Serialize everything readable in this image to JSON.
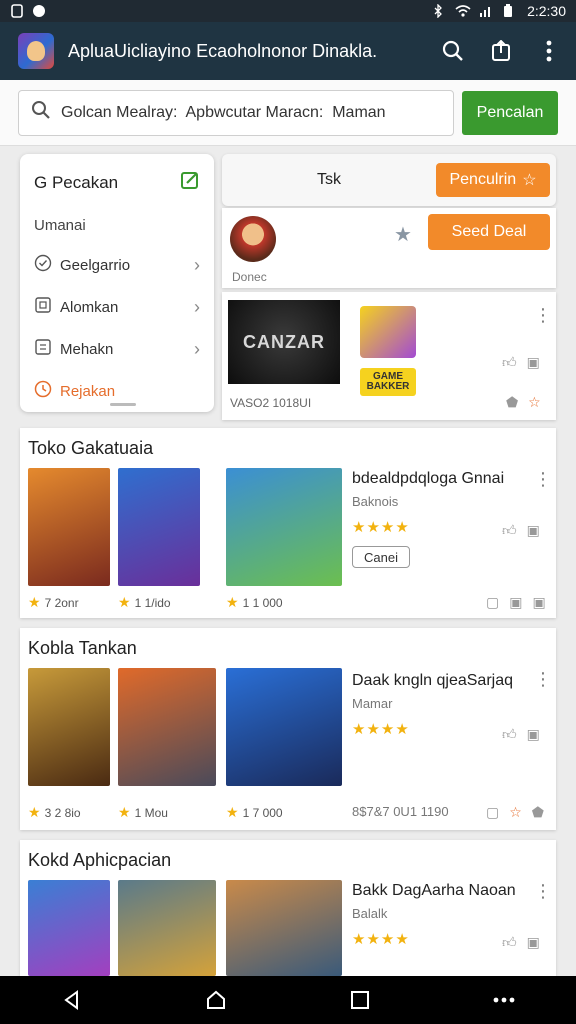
{
  "status_bar": {
    "time": "2:2:30"
  },
  "app_bar": {
    "title": "ApluaUicliayino Ecaoholnonor Dinakla."
  },
  "search": {
    "value": "Golcan Mealray:  Apbwcutar Maracn:  Maman",
    "button": "Pencalan"
  },
  "side_menu": {
    "title": "G Pecakan",
    "subtitle": "Umanai",
    "items": [
      {
        "label": "Geelgarrio"
      },
      {
        "label": "Alomkan"
      },
      {
        "label": "Mehakn"
      }
    ],
    "accent_item": "Rejakan"
  },
  "tab_card": {
    "label": "Tsk",
    "button": "Penculrin"
  },
  "profile_card": {
    "sub": "Donec",
    "button": "Seed Deal"
  },
  "feature_card": {
    "game_title": "CANZAR",
    "badge": "GAME BAKKER",
    "caption": "VASO2 1018UI"
  },
  "sections": [
    {
      "title": "Toko Gakatuaia",
      "tiles": [
        {
          "count": "7 2onr"
        },
        {
          "count": "1 1/ido"
        },
        {
          "count": "1 1 000"
        }
      ],
      "info_title": "bdealdpdqloga Gnnai",
      "info_sub": "Baknois",
      "stars": "★★★★",
      "pill": "Canei",
      "footer": ""
    },
    {
      "title": "Kobla Tankan",
      "tiles": [
        {
          "count": "3 2 8io"
        },
        {
          "count": "1 Mou"
        },
        {
          "count": "1 7 000"
        }
      ],
      "info_title": "Daak kngln qjeaSarjaq",
      "info_sub": "Mamar",
      "stars": "★★★★",
      "pill": "",
      "footer": "8$7&7 0U1 1190"
    },
    {
      "title": "Kokd Aphicpacian",
      "tiles": [
        {
          "count": ""
        },
        {
          "count": ""
        },
        {
          "count": ""
        }
      ],
      "info_title": "Bakk DagAarha Naoan",
      "info_sub": "Balalk",
      "stars": "★★★★",
      "pill": "",
      "footer": ""
    }
  ],
  "tile_art": [
    [
      "#e58a2e",
      "#7a2a1e"
    ],
    [
      "#2f6fcf",
      "#6a2f9a"
    ],
    [
      "#3b8fd4",
      "#6cbf4f"
    ],
    [
      "#c79a3a",
      "#4a2a12"
    ],
    [
      "#e06a2a",
      "#4a4a5a"
    ],
    [
      "#2a6fd6",
      "#1a2a5a"
    ],
    [
      "#3a7fd4",
      "#a33fbf"
    ],
    [
      "#5a7a8a",
      "#d4a23a"
    ],
    [
      "#c98a4a",
      "#3a5a7a"
    ]
  ],
  "colors": {
    "appbar": "#1f3442",
    "search_button": "#3a9a2f",
    "orange": "#f28a2a",
    "star": "#f2b20f"
  }
}
